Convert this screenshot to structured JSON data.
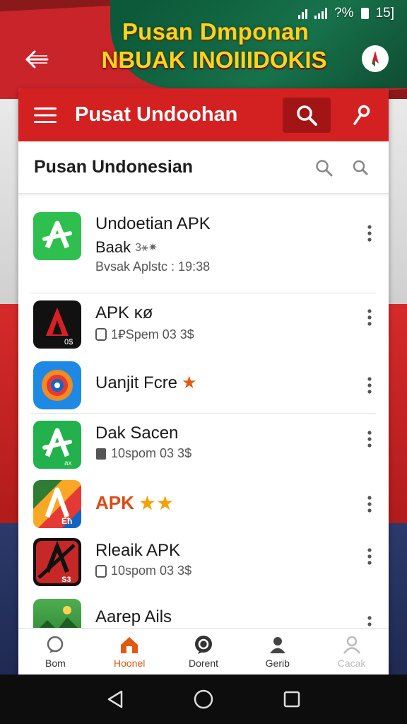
{
  "status_bar": {
    "battery": "?%",
    "time": "15]"
  },
  "banner": {
    "line1": "Pusan Dmponan",
    "line2": "NBUAK INOIIIDOKIS"
  },
  "app_bar": {
    "title": "Pusat Undoohan"
  },
  "search_row": {
    "label": "Pusan Undonesian"
  },
  "apps": [
    {
      "name": "Undoetian APK",
      "sub1": "Baak",
      "sub1_suffix": "3⚹✷",
      "sub2": "Bvsak Aplstc : 19:38",
      "icon": "green-a-icon"
    },
    {
      "name": "APK ĸø",
      "sub": "1⃂Spem  03 3$",
      "icon": "red-a-icon"
    },
    {
      "name": "Uanjit Fcre",
      "icon": "blue-circle-icon",
      "star": "★"
    },
    {
      "name": "Dak Sacen",
      "sub": "10spom  03 3$",
      "icon": "green-a-icon"
    },
    {
      "name": "APK",
      "icon": "rainbow-a-icon",
      "stars": "★★"
    },
    {
      "name": "Rleaik APK",
      "sub": "10spom  03 3$",
      "icon": "red-a-icon"
    },
    {
      "name": "Aarep Ails",
      "icon": "landscape-icon"
    }
  ],
  "icon_badges": {
    "apk_k": "0$",
    "dak_sacen": "ax",
    "apk_rainbow": "Eħ",
    "rleaik": "S3"
  },
  "bottom_nav": [
    {
      "label": "Bom",
      "icon": "chat-icon"
    },
    {
      "label": "Hoonel",
      "icon": "home-icon",
      "active": true
    },
    {
      "label": "Dorent",
      "icon": "comment-icon"
    },
    {
      "label": "Gerib",
      "icon": "person-icon"
    },
    {
      "label": "Cacak",
      "icon": "account-icon"
    }
  ],
  "colors": {
    "app_bar": "#d32121",
    "accent": "#e25a12",
    "star": "#f5a200"
  }
}
